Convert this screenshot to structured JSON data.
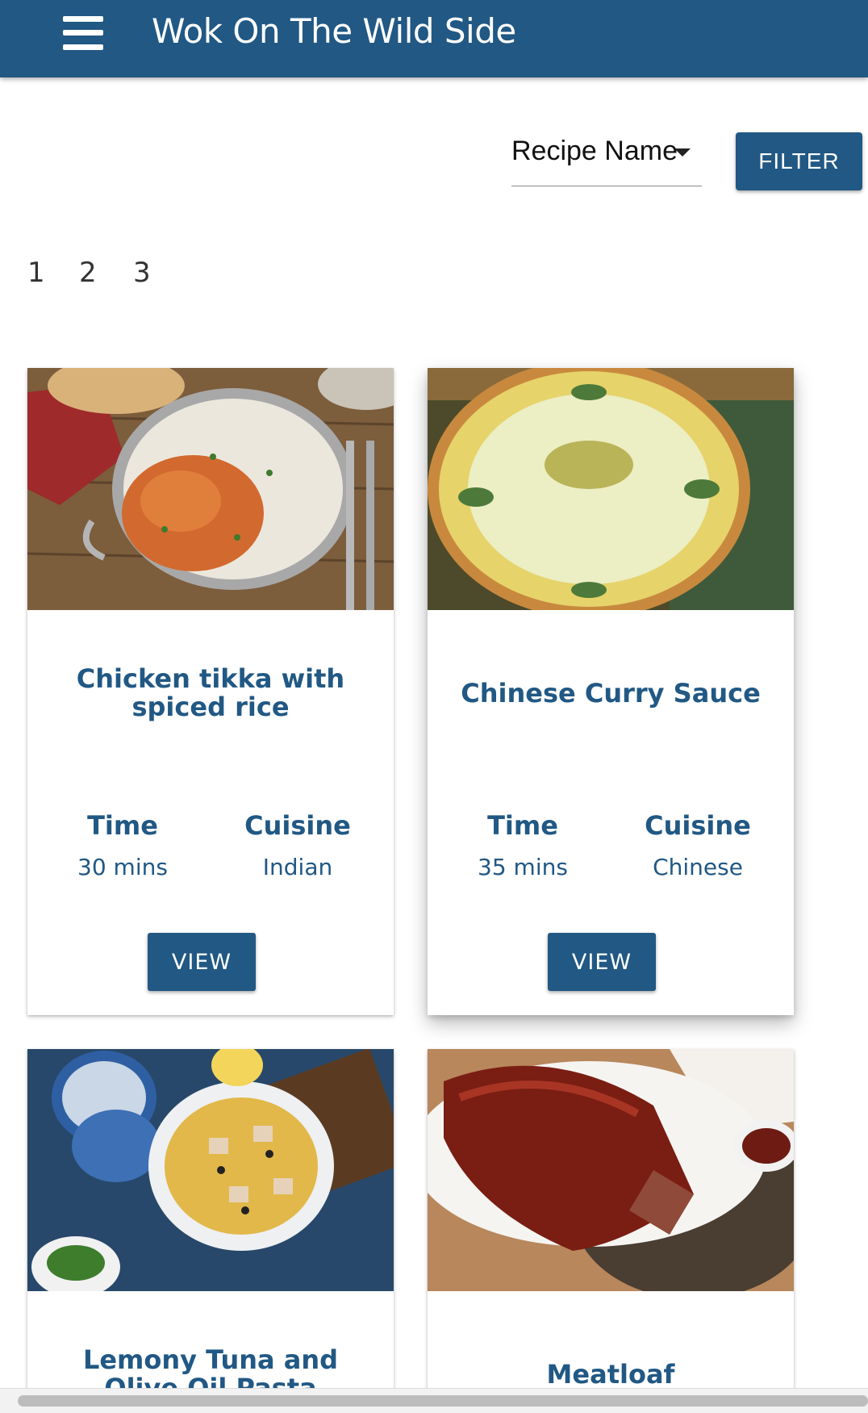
{
  "app": {
    "title": "Wok On The Wild Side"
  },
  "sort": {
    "selected": "Recipe Name"
  },
  "filter": {
    "label": "FILTER"
  },
  "pagination": {
    "pages": [
      "1",
      "2",
      "3"
    ]
  },
  "cards": [
    {
      "title": "Chicken tikka with spiced rice",
      "time_label": "Time",
      "time": "30 mins",
      "cuisine_label": "Cuisine",
      "cuisine": "Indian",
      "button": "VIEW"
    },
    {
      "title": "Chinese Curry Sauce",
      "time_label": "Time",
      "time": "35 mins",
      "cuisine_label": "Cuisine",
      "cuisine": "Chinese",
      "button": "VIEW"
    },
    {
      "title": "Lemony Tuna and Olive Oil Pasta"
    },
    {
      "title": "Meatloaf"
    }
  ],
  "colors": {
    "primary": "#215884",
    "title_text": "#ffffff"
  }
}
